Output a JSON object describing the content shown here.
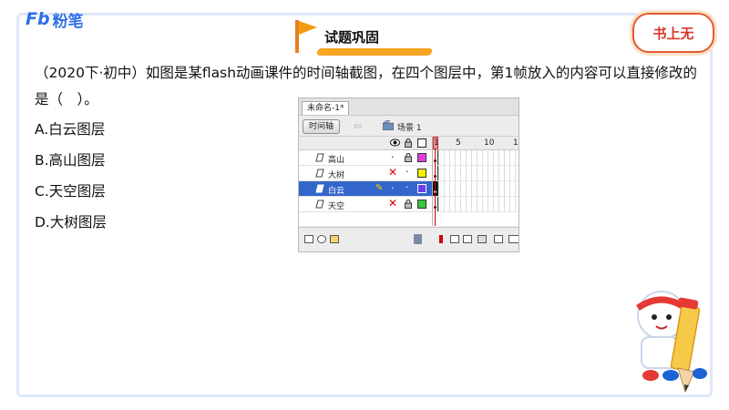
{
  "brand": {
    "logo_text": "粉笔",
    "logo_prefix": "Fb"
  },
  "header": {
    "title": "试题巩固",
    "badge": "书上无"
  },
  "question": {
    "text": "（2020下·初中）如图是某flash动画课件的时间轴截图，在四个图层中，第1帧放入的内容可以直接修改的是（　）。",
    "options": [
      "A.白云图层",
      "B.高山图层",
      "C.天空图层",
      "D.大树图层"
    ]
  },
  "flash": {
    "doc_tab": "未命名-1*",
    "timeline_button": "时间轴",
    "scene": "场景 1",
    "ruler_numbers": [
      "1",
      "5",
      "10",
      "1"
    ],
    "layers": [
      {
        "name": "高山",
        "status": "visible-locked",
        "color": "#e040e0",
        "selected": false
      },
      {
        "name": "大树",
        "status": "hidden",
        "color": "#f4f000",
        "selected": false
      },
      {
        "name": "白云",
        "status": "editing",
        "color": "#6a3df0",
        "selected": true
      },
      {
        "name": "天空",
        "status": "hidden-locked",
        "color": "#35c73d",
        "selected": false
      }
    ]
  },
  "colors": {
    "accent": "#2f6fe6",
    "frame": "#dfe8fb",
    "banner": "#f5a623",
    "badge_red": "#d8382a"
  }
}
